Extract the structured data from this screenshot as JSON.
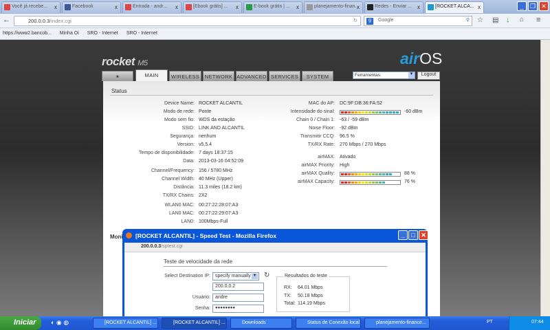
{
  "browser": {
    "tabs": [
      {
        "label": "Você já recebe...",
        "color": "#d44"
      },
      {
        "label": "Facebook",
        "color": "#3b5998"
      },
      {
        "label": "Entrada - andr...",
        "color": "#d44"
      },
      {
        "label": "[Ebook grátis] ...",
        "color": "#d44"
      },
      {
        "label": "E-book grátis | ...",
        "color": "#2a9a4a"
      },
      {
        "label": "planejamento-finan...",
        "color": "#999"
      },
      {
        "label": "Redes - Enviar ...",
        "color": "#222"
      },
      {
        "label": "[ROCKET ALCA...",
        "color": "#29c"
      }
    ],
    "url_host": "200.0.0.3",
    "url_path": "/index.cgi",
    "search_placeholder": "Google",
    "bookmarks": [
      "https://www2.bancob...",
      "Minha Oi",
      "SRO - Internet",
      "SRO - Internet"
    ]
  },
  "header": {
    "product": "rocket",
    "model": "M5",
    "brand_air": "air",
    "brand_os": "OS",
    "tabs": [
      "MAIN",
      "WIRELESS",
      "NETWORK",
      "ADVANCED",
      "SERVICES",
      "SYSTEM"
    ],
    "tools_select": "Ferramentas:",
    "logout": "Logout"
  },
  "status": {
    "title": "Status",
    "left": [
      [
        "Device Name:",
        "ROCKET ALCANTIL"
      ],
      [
        "Modo de rede:",
        "Ponte"
      ],
      [
        "Modo sem fio:",
        "WDS da estação"
      ],
      [
        "SSID:",
        "LINK AND ALCANTIL"
      ],
      [
        "Segurança:",
        "nenhum"
      ],
      [
        "Version:",
        "v5.5.4"
      ],
      [
        "Tempo de disponibilidade:",
        "7 days 18:37:15"
      ],
      [
        "Data:",
        "2013-03-16 04:52:09"
      ],
      [
        "Channel/Frequency:",
        "156 / 5780 MHz"
      ],
      [
        "Channel Width:",
        "40 MHz (Upper)"
      ],
      [
        "Distância:",
        "11.3 miles (18.2 km)"
      ],
      [
        "TX/RX Chains:",
        "2X2"
      ],
      [
        "WLAN0 MAC:",
        "00:27:22:28:07:A3"
      ],
      [
        "LAN0 MAC:",
        "00:27:22:29:07:A3"
      ],
      [
        "LAN0:",
        "100Mbps-Full"
      ]
    ],
    "right": [
      [
        "MAC do AP:",
        "DC:9F:DB:36:FA:52"
      ],
      [
        "Intensidade do sinal:",
        "-60 dBm"
      ],
      [
        "Chain 0 / Chain 1:",
        "-63 / -59 dBm"
      ],
      [
        "Noise Floor:",
        "-92 dBm"
      ],
      [
        "Transmitir CCQ:",
        "96.5 %"
      ],
      [
        "TX/RX Rate:",
        "270 Mbps / 270 Mbps"
      ],
      [
        "airMAX:",
        "Ativado"
      ],
      [
        "airMAX Priority:",
        "High"
      ],
      [
        "airMAX Quality:",
        "88 %"
      ],
      [
        "airMAX Capacity:",
        "76 %"
      ]
    ],
    "signal_fraction": 1.0,
    "quality_percent": 88,
    "capacity_percent": 76,
    "monitor_label": "Moni"
  },
  "popup": {
    "title": "[ROCKET ALCANTIL] - Speed Test - Mozilla Firefox",
    "url_host": "200.0.0.3",
    "url_path": "/sptest.cgi",
    "heading": "Teste de velocidade da rede",
    "dest_label": "Select Destination IP:",
    "dest_value": "specify manually",
    "ip": "200.0.0.2",
    "user_label": "Usuário:",
    "user": "andre",
    "pass_label": "Senha:",
    "pass": "●●●●●●●●",
    "results_title": "Resultados do teste",
    "rx_label": "RX:",
    "rx": "64.01 Mbps",
    "tx_label": "TX:",
    "tx": "50.18 Mbps",
    "total_label": "Total:",
    "total": "114.19 Mbps"
  },
  "taskbar": {
    "start": "Iniciar",
    "items": [
      "[ROCKET ALCANTIL] ...",
      "[ROCKET ALCANTIL] ...",
      "Downloads",
      "Status de Conexão local",
      "planejamento-finance..."
    ],
    "lang": "PT",
    "clock": "07:44"
  }
}
